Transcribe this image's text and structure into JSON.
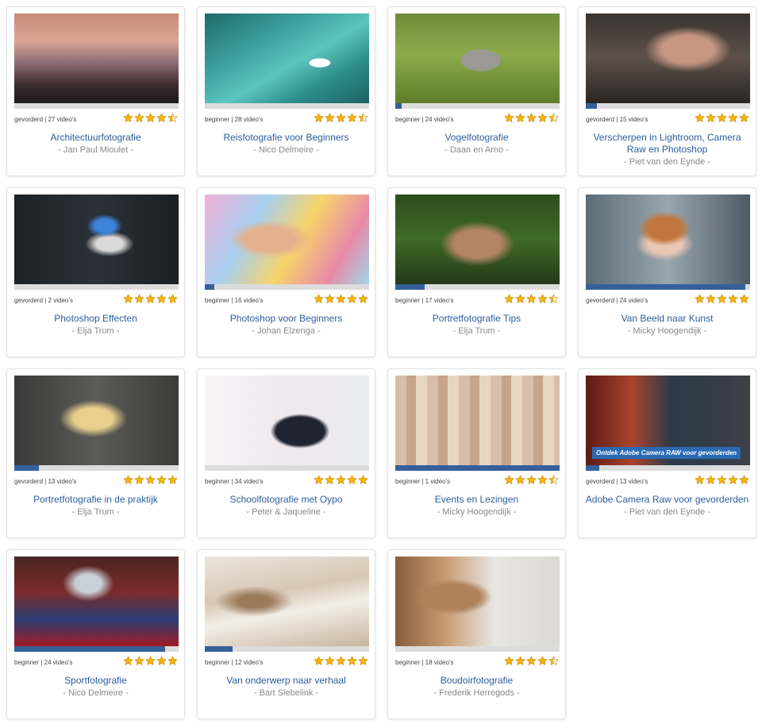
{
  "courses": [
    {
      "title": "Architectuurfotografie",
      "author": "- Jan Paul Mioulet -",
      "level": "gevorderd",
      "videos": "27 video's",
      "rating": 4.5,
      "progress": 0,
      "image": "modern-office-building-at-sunset",
      "overlay": ""
    },
    {
      "title": "Reisfotografie voor Beginners",
      "author": "- Nico Delmeire -",
      "level": "beginner",
      "videos": "28 video's",
      "rating": 4.5,
      "progress": 0,
      "image": "aerial-boat-on-turquoise-sea",
      "overlay": ""
    },
    {
      "title": "Vogelfotografie",
      "author": "- Daan en Arno -",
      "level": "beginner",
      "videos": "24 video's",
      "rating": 4.5,
      "progress": 0.04,
      "image": "cuckoo-bird-in-grass",
      "overlay": ""
    },
    {
      "title": "Verscherpen in Lightroom, Camera Raw en Photoshop",
      "author": "- Piet van den Eynde -",
      "level": "gevorderd",
      "videos": "15 video's",
      "rating": 5,
      "progress": 0.07,
      "image": "dancer-with-flowing-fabric",
      "overlay": ""
    },
    {
      "title": "Photoshop Effecten",
      "author": "- Elja Trum -",
      "level": "gevorderd",
      "videos": "2 video's",
      "rating": 5,
      "progress": 0,
      "image": "dispersion-effect-dancer",
      "overlay": ""
    },
    {
      "title": "Photoshop voor Beginners",
      "author": "- Johan Elzenga -",
      "level": "beginner",
      "videos": "16 video's",
      "rating": 5,
      "progress": 0.06,
      "image": "colorful-painted-portrait",
      "overlay": ""
    },
    {
      "title": "Portretfotografie Tips",
      "author": "- Elja Trum -",
      "level": "beginner",
      "videos": "17 video's",
      "rating": 4.5,
      "progress": 0.18,
      "image": "freckled-woman-portrait",
      "overlay": ""
    },
    {
      "title": "Van Beeld naar Kunst",
      "author": "- Micky Hoogendijk -",
      "level": "gevorderd",
      "videos": "24 video's",
      "rating": 5,
      "progress": 0.97,
      "image": "red-haired-woman-with-ice",
      "overlay": ""
    },
    {
      "title": "Portretfotografie in de praktijk",
      "author": "- Elja Trum -",
      "level": "gevorderd",
      "videos": "13 video's",
      "rating": 5,
      "progress": 0.15,
      "image": "blonde-woman-portrait",
      "overlay": ""
    },
    {
      "title": "Schoolfotografie met Oypo",
      "author": "- Peter & Jaqueline -",
      "level": "beginner",
      "videos": "34 video's",
      "rating": 5,
      "progress": 0,
      "image": "two-boys-in-studio",
      "overlay": ""
    },
    {
      "title": "Events en Lezingen",
      "author": "- Micky Hoogendijk -",
      "level": "beginner",
      "videos": "1 video's",
      "rating": 4.5,
      "progress": 1,
      "image": "blurred-figures-montage",
      "overlay": ""
    },
    {
      "title": "Adobe Camera Raw voor gevorderden",
      "author": "- Piet van den Eynde -",
      "level": "gevorderd",
      "videos": "13 video's",
      "rating": 5,
      "progress": 0.08,
      "image": "man-with-cap-and-screen",
      "overlay": "Ontdek Adobe Camera RAW voor gevorderden"
    },
    {
      "title": "Sportfotografie",
      "author": "- Nico Delmeire -",
      "level": "beginner",
      "videos": "24 video's",
      "rating": 5,
      "progress": 0.92,
      "image": "football-team-celebrating-trophy",
      "overlay": ""
    },
    {
      "title": "Van onderwerp naar verhaal",
      "author": "- Bart Siebelink -",
      "level": "beginner",
      "videos": "12 video's",
      "rating": 5,
      "progress": 0.17,
      "image": "abstract-macro-texture",
      "overlay": ""
    },
    {
      "title": "Boudoirfotografie",
      "author": "- Frederik Herregods -",
      "level": "beginner",
      "videos": "18 video's",
      "rating": 4.5,
      "progress": 0,
      "image": "smiling-woman-by-wooden-post",
      "overlay": ""
    }
  ],
  "colors": {
    "title": "#2b5d9e",
    "progress": "#36609a",
    "track": "#dcdcdc",
    "star": "#f5b50a",
    "star_outline": "#c7870a"
  }
}
